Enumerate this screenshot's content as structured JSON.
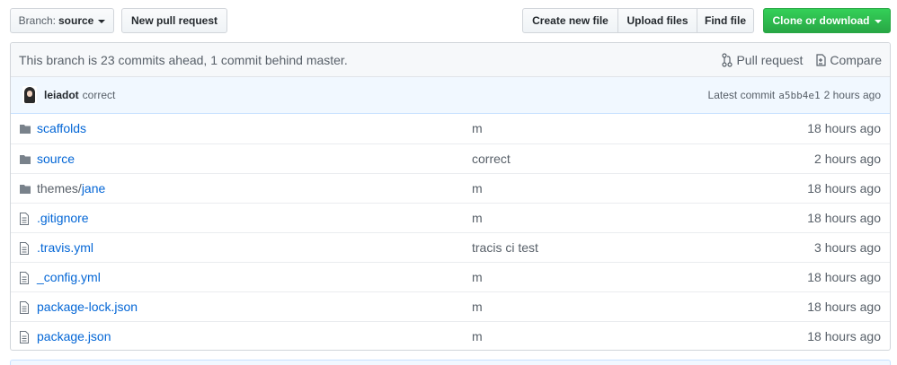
{
  "toolbar": {
    "branch_prefix": "Branch:",
    "branch_name": "source",
    "new_pull_request": "New pull request",
    "create_new_file": "Create new file",
    "upload_files": "Upload files",
    "find_file": "Find file",
    "clone_or_download": "Clone or download"
  },
  "branch_status": {
    "text": "This branch is 23 commits ahead, 1 commit behind master.",
    "pull_request": "Pull request",
    "compare": "Compare"
  },
  "latest_commit": {
    "author": "leiadot",
    "message": "correct",
    "label": "Latest commit",
    "sha": "a5bb4e1",
    "age": "2 hours ago"
  },
  "files": [
    {
      "type": "dir",
      "icon": "folder-icon",
      "prefix": "",
      "name": "scaffolds",
      "message": "m",
      "age": "18 hours ago"
    },
    {
      "type": "dir",
      "icon": "folder-icon",
      "prefix": "",
      "name": "source",
      "message": "correct",
      "age": "2 hours ago"
    },
    {
      "type": "dir",
      "icon": "folder-icon",
      "prefix": "themes/",
      "name": "jane",
      "message": "m",
      "age": "18 hours ago"
    },
    {
      "type": "file",
      "icon": "file-icon",
      "prefix": "",
      "name": ".gitignore",
      "message": "m",
      "age": "18 hours ago"
    },
    {
      "type": "file",
      "icon": "file-icon",
      "prefix": "",
      "name": ".travis.yml",
      "message": "tracis ci test",
      "age": "3 hours ago"
    },
    {
      "type": "file",
      "icon": "file-icon",
      "prefix": "",
      "name": "_config.yml",
      "message": "m",
      "age": "18 hours ago"
    },
    {
      "type": "file",
      "icon": "file-icon",
      "prefix": "",
      "name": "package-lock.json",
      "message": "m",
      "age": "18 hours ago"
    },
    {
      "type": "file",
      "icon": "file-icon",
      "prefix": "",
      "name": "package.json",
      "message": "m",
      "age": "18 hours ago"
    }
  ],
  "colors": {
    "link": "#0366d6",
    "muted": "#586069",
    "clone_green": "#28a745",
    "commit_bg": "#f1f8ff",
    "icon_gray": "#79828b"
  }
}
